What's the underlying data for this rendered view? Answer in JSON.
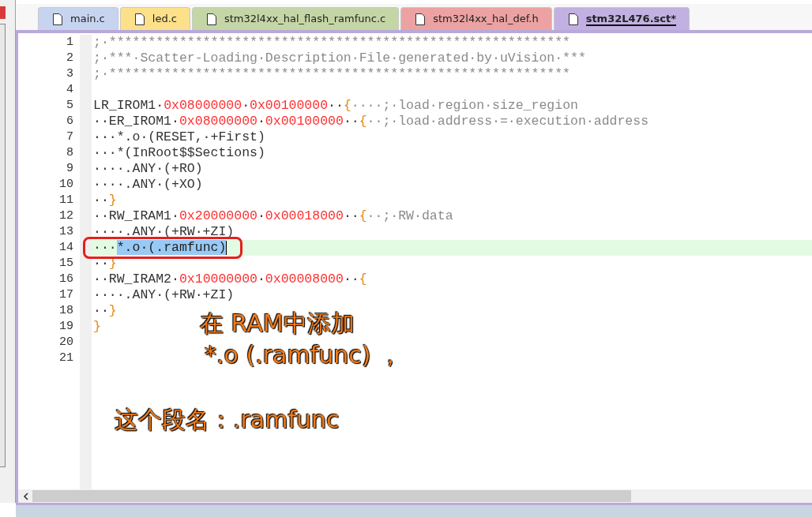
{
  "tabs": [
    {
      "label": "main.c",
      "color": "#c6d4f0",
      "selected": false
    },
    {
      "label": "led.c",
      "color": "#fde08a",
      "selected": false
    },
    {
      "label": "stm32l4xx_hal_flash_ramfunc.c",
      "color": "#c4d6a6",
      "selected": false
    },
    {
      "label": "stm32l4xx_hal_def.h",
      "color": "#eca2a2",
      "selected": false
    },
    {
      "label": "stm32L476.sct*",
      "color": "#c2b0e2",
      "selected": true
    }
  ],
  "editor": {
    "lines": [
      {
        "number": "1",
        "current": false,
        "segments": [
          {
            "kind": "comment",
            "text": ";·***********************************************************"
          }
        ]
      },
      {
        "number": "2",
        "current": false,
        "segments": [
          {
            "kind": "comment",
            "text": ";·***·Scatter-Loading·Description·File·generated·by·uVision·***"
          }
        ]
      },
      {
        "number": "3",
        "current": false,
        "segments": [
          {
            "kind": "comment",
            "text": ";·***********************************************************"
          }
        ]
      },
      {
        "number": "4",
        "current": false
      },
      {
        "number": "5",
        "current": false,
        "segments": [
          {
            "kind": "code",
            "text": "LR_IROM1·"
          },
          {
            "kind": "number",
            "text": "0x08000000"
          },
          {
            "kind": "code",
            "text": "·"
          },
          {
            "kind": "number",
            "text": "0x00100000"
          },
          {
            "kind": "code",
            "text": "··"
          },
          {
            "kind": "brace",
            "text": "{"
          },
          {
            "kind": "comment",
            "text": "····;·load·region·size_region"
          }
        ]
      },
      {
        "number": "6",
        "current": false,
        "segments": [
          {
            "kind": "code",
            "text": "··ER_IROM1·"
          },
          {
            "kind": "number",
            "text": "0x08000000"
          },
          {
            "kind": "code",
            "text": "·"
          },
          {
            "kind": "number",
            "text": "0x00100000"
          },
          {
            "kind": "code",
            "text": "··"
          },
          {
            "kind": "brace",
            "text": "{"
          },
          {
            "kind": "comment",
            "text": "··;·load·address·=·execution·address"
          }
        ]
      },
      {
        "number": "7",
        "current": false,
        "segments": [
          {
            "kind": "code",
            "text": "···*.o·(RESET,·+First)"
          }
        ]
      },
      {
        "number": "8",
        "current": false,
        "segments": [
          {
            "kind": "code",
            "text": "···*(InRoot$$Sections)"
          }
        ]
      },
      {
        "number": "9",
        "current": false,
        "segments": [
          {
            "kind": "code",
            "text": "····.ANY·(+RO)"
          }
        ]
      },
      {
        "number": "10",
        "current": false,
        "segments": [
          {
            "kind": "code",
            "text": "····.ANY·(+XO)"
          }
        ]
      },
      {
        "number": "11",
        "current": false,
        "segments": [
          {
            "kind": "code",
            "text": "··"
          },
          {
            "kind": "brace",
            "text": "}"
          }
        ]
      },
      {
        "number": "12",
        "current": false,
        "segments": [
          {
            "kind": "code",
            "text": "··RW_IRAM1·"
          },
          {
            "kind": "number",
            "text": "0x20000000"
          },
          {
            "kind": "code",
            "text": "·"
          },
          {
            "kind": "number",
            "text": "0x00018000"
          },
          {
            "kind": "code",
            "text": "··"
          },
          {
            "kind": "brace",
            "text": "{"
          },
          {
            "kind": "comment",
            "text": "··;·RW·data"
          }
        ]
      },
      {
        "number": "13",
        "current": false,
        "segments": [
          {
            "kind": "code",
            "text": "····.ANY·(+RW·+ZI)"
          }
        ]
      },
      {
        "number": "14",
        "current": true,
        "segments": [
          {
            "kind": "code",
            "text": "···"
          },
          {
            "kind": "selection",
            "text": "*.o·(.ramfunc)"
          }
        ]
      },
      {
        "number": "15",
        "current": false,
        "segments": [
          {
            "kind": "code",
            "text": "··"
          },
          {
            "kind": "brace",
            "text": "}"
          }
        ]
      },
      {
        "number": "16",
        "current": false,
        "segments": [
          {
            "kind": "code",
            "text": "··RW_IRAM2·"
          },
          {
            "kind": "number",
            "text": "0x10000000"
          },
          {
            "kind": "code",
            "text": "·"
          },
          {
            "kind": "number",
            "text": "0x00008000"
          },
          {
            "kind": "code",
            "text": "··"
          },
          {
            "kind": "brace",
            "text": "{"
          }
        ]
      },
      {
        "number": "17",
        "current": false,
        "segments": [
          {
            "kind": "code",
            "text": "····.ANY·(+RW·+ZI)"
          }
        ]
      },
      {
        "number": "18",
        "current": false,
        "segments": [
          {
            "kind": "code",
            "text": "··"
          },
          {
            "kind": "brace",
            "text": "}"
          }
        ]
      },
      {
        "number": "19",
        "current": false,
        "segments": [
          {
            "kind": "brace",
            "text": "}"
          }
        ]
      },
      {
        "number": "20",
        "current": false
      },
      {
        "number": "21",
        "current": false
      }
    ]
  },
  "annotations": [
    "在 RAM中添加",
    "*.o (.ramfunc) ，",
    "这个段名：.ramfunc"
  ]
}
